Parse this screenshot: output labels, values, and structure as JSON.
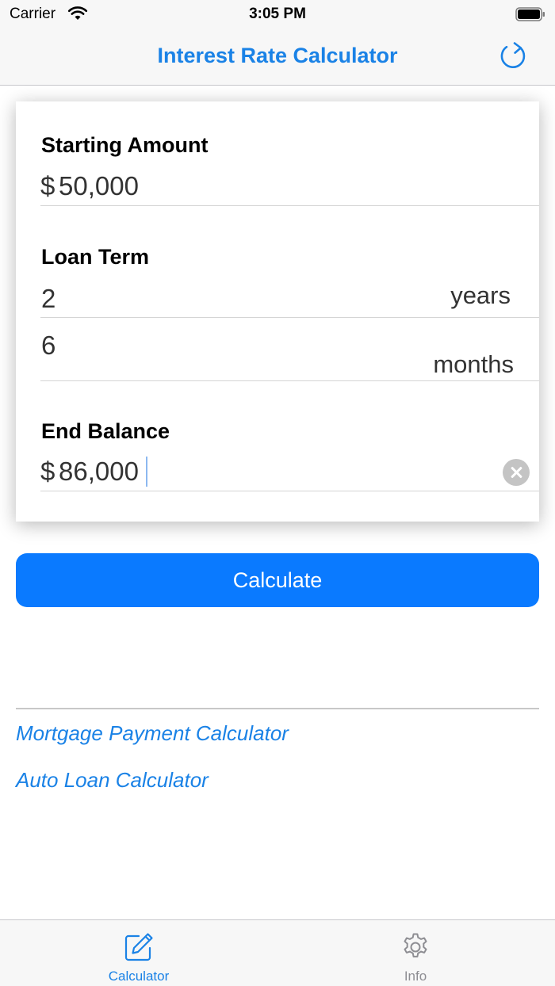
{
  "status_bar": {
    "carrier": "Carrier",
    "time": "3:05 PM"
  },
  "nav": {
    "title": "Interest Rate Calculator",
    "refresh_icon": "refresh-icon"
  },
  "form": {
    "starting_amount": {
      "label": "Starting Amount",
      "prefix": "$",
      "value": "50,000"
    },
    "loan_term": {
      "label": "Loan Term",
      "years": {
        "value": "2",
        "unit": "years"
      },
      "months": {
        "value": "6",
        "unit": "months"
      }
    },
    "end_balance": {
      "label": "End Balance",
      "prefix": "$",
      "value": "86,000"
    }
  },
  "calculate_label": "Calculate",
  "links": [
    {
      "label": "Mortgage Payment Calculator"
    },
    {
      "label": "Auto Loan Calculator"
    }
  ],
  "tabs": [
    {
      "label": "Calculator",
      "icon": "edit-icon",
      "active": true
    },
    {
      "label": "Info",
      "icon": "gear-icon",
      "active": false
    }
  ],
  "colors": {
    "accent": "#1a82e6",
    "button": "#0a7aff",
    "inactive_tab": "#8e8e93"
  }
}
